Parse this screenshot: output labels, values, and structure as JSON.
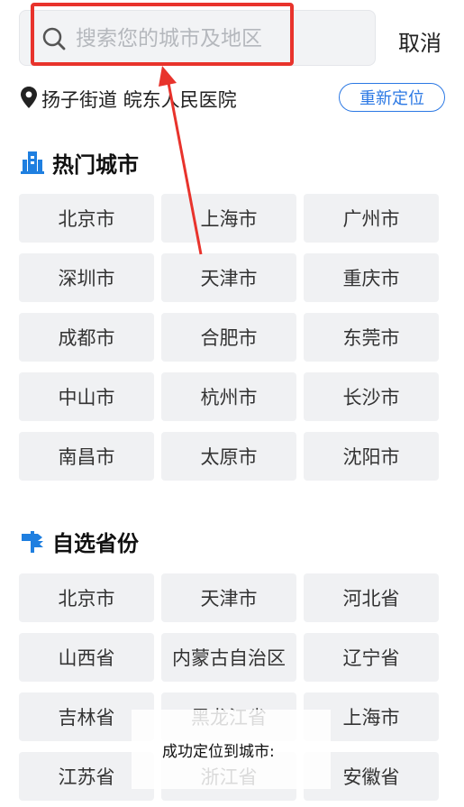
{
  "search": {
    "placeholder": "搜索您的城市及地区",
    "cancel_label": "取消"
  },
  "location": {
    "current_text": "扬子街道 皖东人民医院",
    "relocate_label": "重新定位"
  },
  "hot_cities": {
    "title": "热门城市",
    "items": [
      "北京市",
      "上海市",
      "广州市",
      "深圳市",
      "天津市",
      "重庆市",
      "成都市",
      "合肥市",
      "东莞市",
      "中山市",
      "杭州市",
      "长沙市",
      "南昌市",
      "太原市",
      "沈阳市"
    ]
  },
  "provinces": {
    "title": "自选省份",
    "items": [
      "北京市",
      "天津市",
      "河北省",
      "山西省",
      "内蒙古自治区",
      "辽宁省",
      "吉林省",
      "黑龙江省",
      "上海市",
      "江苏省",
      "浙江省",
      "安徽省"
    ]
  },
  "toast": {
    "text": "成功定位到城市:"
  },
  "colors": {
    "accent": "#2b78e4",
    "highlight": "#e8332c",
    "cell_bg": "#f0f1f3"
  },
  "icons": {
    "search": "search-icon",
    "location": "location-pin-icon",
    "hot": "building-icon",
    "province": "signpost-icon"
  }
}
